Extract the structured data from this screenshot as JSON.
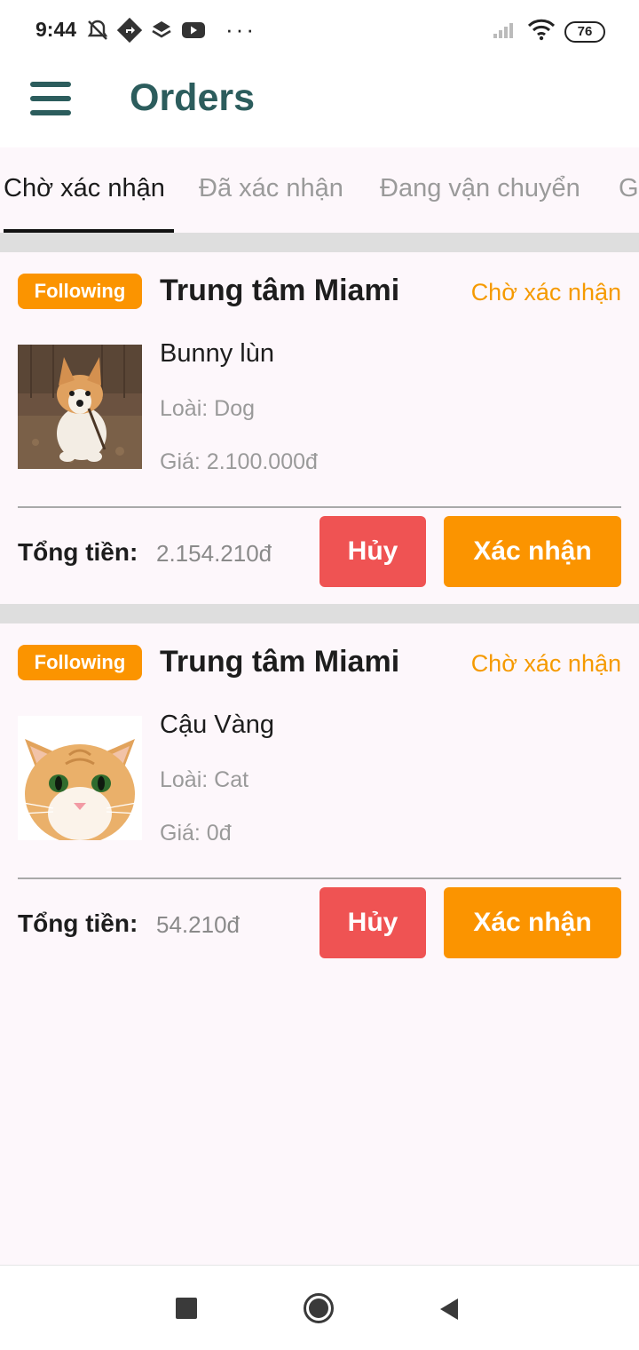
{
  "status_bar": {
    "time": "9:44",
    "battery": "76"
  },
  "app_bar": {
    "title": "Orders"
  },
  "tabs": [
    {
      "label": "Chờ xác nhận",
      "active": true
    },
    {
      "label": "Đã xác nhận",
      "active": false
    },
    {
      "label": "Đang vận chuyển",
      "active": false
    },
    {
      "label": "G",
      "active": false
    }
  ],
  "orders": [
    {
      "badge": "Following",
      "shop": "Trung tâm Miami",
      "status": "Chờ xác nhận",
      "pet_name": "Bunny lùn",
      "species": "Loài: Dog",
      "price": "Giá: 2.100.000đ",
      "total_label": "Tổng tiền:",
      "total_value": "2.154.210đ",
      "cancel_label": "Hủy",
      "confirm_label": "Xác nhận"
    },
    {
      "badge": "Following",
      "shop": "Trung tâm Miami",
      "status": "Chờ xác nhận",
      "pet_name": "Cậu Vàng",
      "species": "Loài: Cat",
      "price": "Giá: 0đ",
      "total_label": "Tổng tiền:",
      "total_value": "54.210đ",
      "cancel_label": "Hủy",
      "confirm_label": "Xác nhận"
    }
  ],
  "colors": {
    "accent": "#fb9400",
    "title": "#2c5d5d",
    "cancel": "#ef5353"
  }
}
